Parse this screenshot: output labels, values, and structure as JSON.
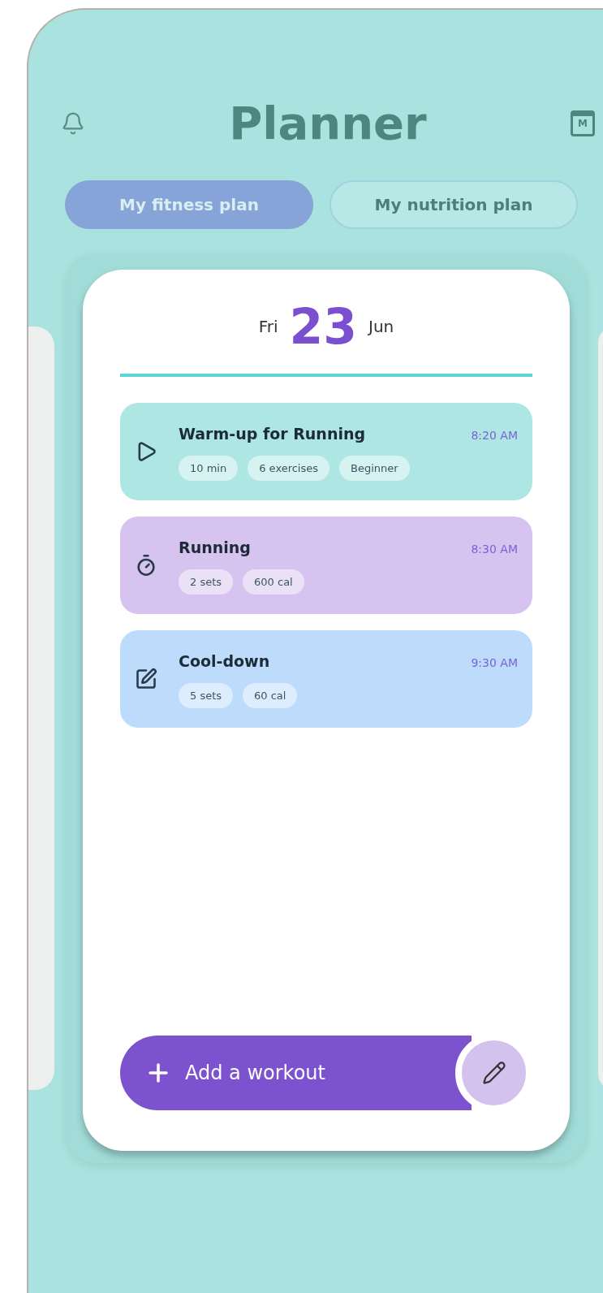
{
  "header": {
    "title": "Planner",
    "calendar_letter": "M"
  },
  "tabs": [
    {
      "label": "My fitness plan",
      "selected": true
    },
    {
      "label": "My nutrition plan",
      "selected": false
    }
  ],
  "date": {
    "weekday": "Fri",
    "day": "23",
    "month": "Jun"
  },
  "workouts": [
    {
      "kind": "play",
      "title": "Warm-up for Running",
      "time": "8:20 AM",
      "color": "#ade6e2",
      "tags": [
        "10 min",
        "6 exercises",
        "Beginner"
      ]
    },
    {
      "kind": "stopwatch",
      "title": "Running",
      "time": "8:30 AM",
      "color": "#d7c3ef",
      "tags": [
        "2 sets",
        "600 cal"
      ]
    },
    {
      "kind": "edit",
      "title": "Cool-down",
      "time": "9:30 AM",
      "color": "#bddbfb",
      "tags": [
        "5 sets",
        "60 cal"
      ]
    }
  ],
  "add_button": {
    "label": "Add a workout"
  }
}
